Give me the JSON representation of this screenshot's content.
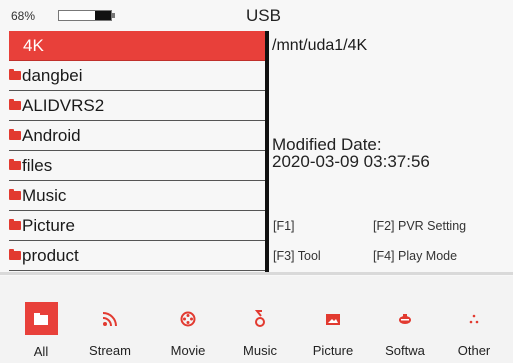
{
  "status": {
    "battery_percent": "68%",
    "battery_level": 0.3,
    "title": "USB"
  },
  "files": [
    {
      "label": "4K",
      "selected": true
    },
    {
      "label": "dangbei",
      "selected": false
    },
    {
      "label": "ALIDVRS2",
      "selected": false
    },
    {
      "label": "Android",
      "selected": false
    },
    {
      "label": "files",
      "selected": false
    },
    {
      "label": "Music",
      "selected": false
    },
    {
      "label": "Picture",
      "selected": false
    },
    {
      "label": "product",
      "selected": false
    }
  ],
  "info": {
    "path": "/mnt/uda1/4K",
    "modified_label": "Modified Date:",
    "modified_value": "2020-03-09 03:37:56"
  },
  "fkeys": {
    "f1": "[F1]",
    "f2": "[F2] PVR Setting",
    "f3": "[F3] Tool",
    "f4": "[F4] Play Mode"
  },
  "tabs": [
    {
      "label": "All",
      "icon": "folder-icon",
      "glyph": "▬",
      "active": true
    },
    {
      "label": "Stream",
      "icon": "rss-icon",
      "glyph": "≈",
      "active": false
    },
    {
      "label": "Movie",
      "icon": "film-reel-icon",
      "glyph": "⊗",
      "active": false
    },
    {
      "label": "Music",
      "icon": "music-note-icon",
      "glyph": "δ",
      "active": false
    },
    {
      "label": "Picture",
      "icon": "picture-icon",
      "glyph": "▬",
      "active": false
    },
    {
      "label": "Softwa",
      "icon": "software-icon",
      "glyph": "○",
      "active": false
    },
    {
      "label": "Other",
      "icon": "other-icon",
      "glyph": "∴",
      "active": false
    }
  ],
  "colors": {
    "accent": "#e8403a",
    "folder": "#e23a30"
  }
}
